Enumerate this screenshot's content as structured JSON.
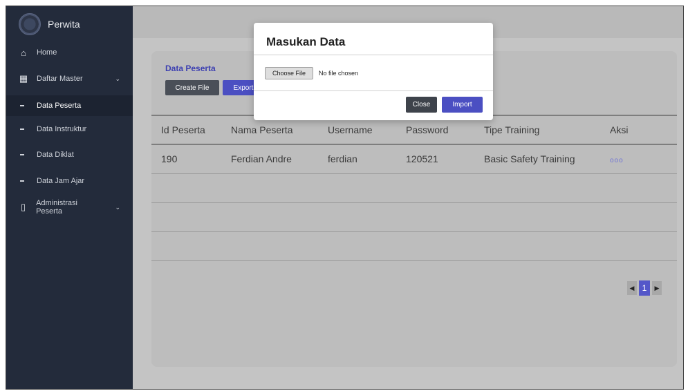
{
  "brand": {
    "name": "Perwita",
    "logo": "logo-emblem"
  },
  "sidebar": {
    "items": [
      {
        "label": "Home",
        "icon": "home-icon"
      },
      {
        "label": "Daftar Master",
        "icon": "grid-table-icon",
        "chevron": "⌄"
      },
      {
        "label": "Data Peserta",
        "active": true
      },
      {
        "label": "Data Instruktur"
      },
      {
        "label": "Data Diklat"
      },
      {
        "label": "Data Jam Ajar"
      },
      {
        "label": "Administrasi Peserta",
        "icon": "clipboard-icon",
        "chevron": "⌄"
      }
    ]
  },
  "card": {
    "title": "Data Peserta",
    "create_label": "Create File",
    "export_label": "Export"
  },
  "table": {
    "headers": [
      "Id Peserta",
      "Nama Peserta",
      "Username",
      "Password",
      "Tipe Training",
      "Aksi"
    ],
    "rows": [
      [
        "190",
        "Ferdian Andre",
        "ferdian",
        "120521",
        "Basic Safety Training",
        "ooo"
      ],
      [
        "",
        "",
        "",
        "",
        "",
        ""
      ],
      [
        "",
        "",
        "",
        "",
        "",
        ""
      ],
      [
        "",
        "",
        "",
        "",
        "",
        ""
      ]
    ]
  },
  "pagination": {
    "prev": "◀",
    "current": "1",
    "next": "▶"
  },
  "modal": {
    "title": "Masukan Data",
    "file_button": "Choose File",
    "file_status": "No file chosen",
    "close_label": "Close",
    "import_label": "Import"
  },
  "colors": {
    "sidebar": "#232b3b",
    "accent": "#4b4fc2",
    "title": "#3c3fb1",
    "dark_button": "#4a4f58"
  }
}
